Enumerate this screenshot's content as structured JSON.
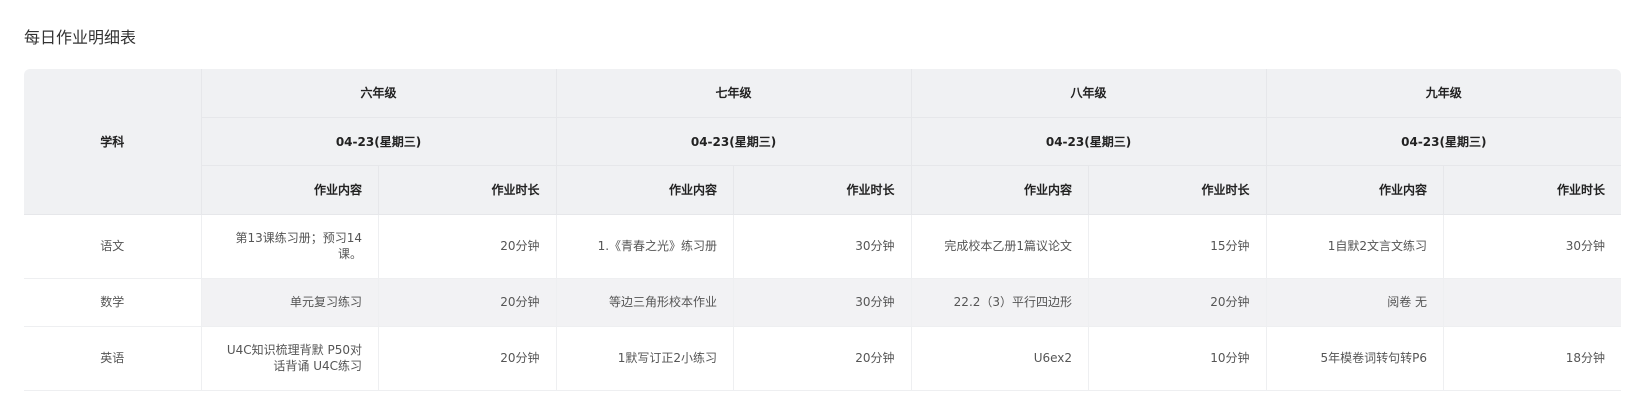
{
  "title": "每日作业明细表",
  "table": {
    "subject_header": "学科",
    "grades": [
      {
        "name": "六年级",
        "date": "04-23(星期三)"
      },
      {
        "name": "七年级",
        "date": "04-23(星期三)"
      },
      {
        "name": "八年级",
        "date": "04-23(星期三)"
      },
      {
        "name": "九年级",
        "date": "04-23(星期三)"
      }
    ],
    "content_header": "作业内容",
    "duration_header": "作业时长",
    "rows": [
      {
        "subject": "语文",
        "cells": [
          {
            "content": "第13课练习册；预习14课。",
            "duration": "20分钟"
          },
          {
            "content": "1.《青春之光》练习册",
            "duration": "30分钟"
          },
          {
            "content": "完成校本乙册1篇议论文",
            "duration": "15分钟"
          },
          {
            "content": "1自默2文言文练习",
            "duration": "30分钟"
          }
        ]
      },
      {
        "subject": "数学",
        "cells": [
          {
            "content": "单元复习练习",
            "duration": "20分钟"
          },
          {
            "content": "等边三角形校本作业",
            "duration": "30分钟"
          },
          {
            "content": "22.2（3）平行四边形",
            "duration": "20分钟"
          },
          {
            "content": "阅卷 无",
            "duration": ""
          }
        ]
      },
      {
        "subject": "英语",
        "cells": [
          {
            "content": "U4C知识梳理背默 P50对话背诵 U4C练习",
            "duration": "20分钟"
          },
          {
            "content": "1默写订正2小练习",
            "duration": "20分钟"
          },
          {
            "content": "U6ex2",
            "duration": "10分钟"
          },
          {
            "content": "5年模卷词转句转P6",
            "duration": "18分钟"
          }
        ]
      }
    ]
  }
}
